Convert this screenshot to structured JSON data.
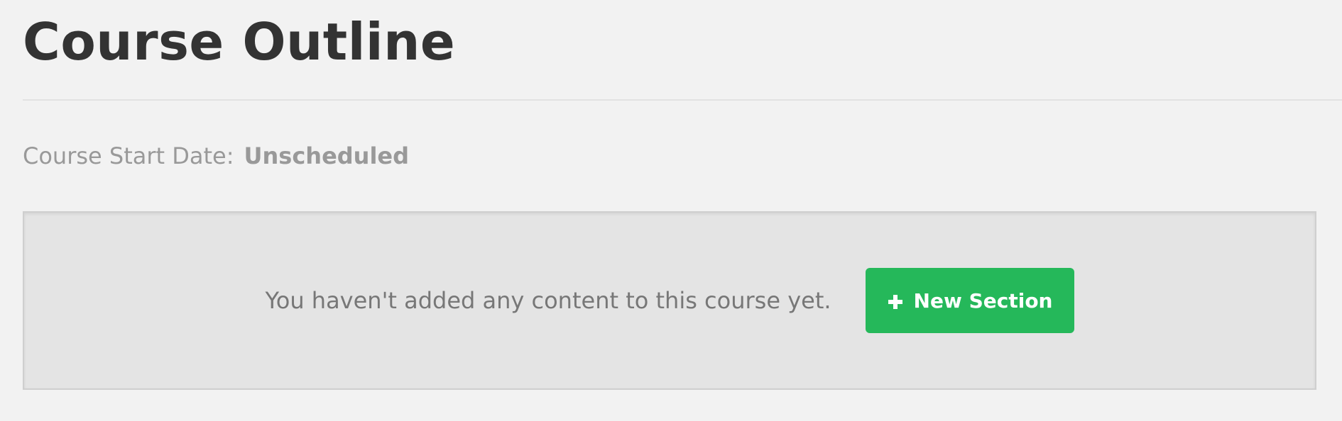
{
  "page": {
    "title": "Course Outline"
  },
  "course_start": {
    "label": "Course Start Date:",
    "value": "Unscheduled"
  },
  "empty_state": {
    "message": "You haven't added any content to this course yet.",
    "button_label": "New Section",
    "button_icon": "plus-icon",
    "button_color": "#25b85a"
  }
}
